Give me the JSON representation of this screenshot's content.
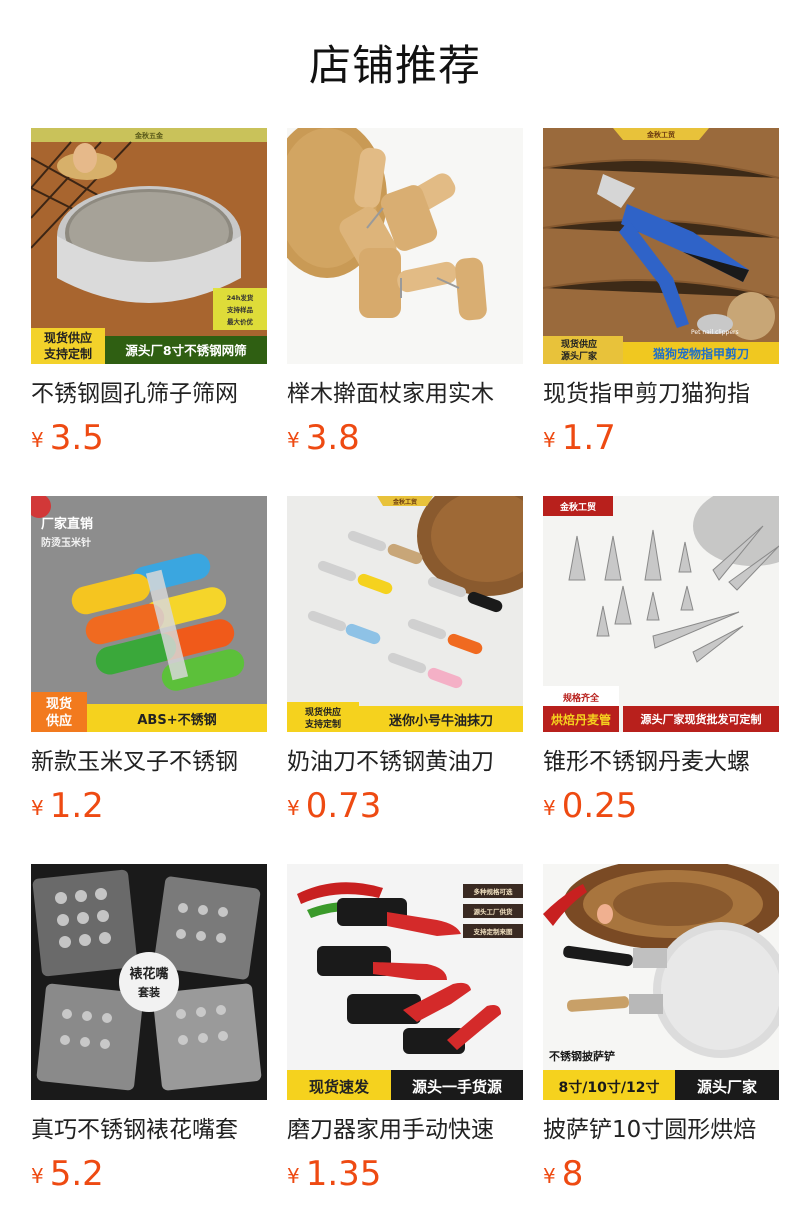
{
  "page": {
    "title": "店铺推荐"
  },
  "currency": "¥",
  "products": [
    {
      "name": "不锈钢圆孔筛子筛网",
      "price": "3.5",
      "image": {
        "icon": "sieve-image",
        "top_text": "金秋五金",
        "badge_lines": [
          "现货供应",
          "支持定制"
        ],
        "banner": "源头厂8寸不锈钢网筛",
        "tags": [
          "24h发货",
          "支持样品",
          "最大价优"
        ]
      }
    },
    {
      "name": "榉木擀面杖家用实木",
      "price": "3.8",
      "image": {
        "icon": "rolling-pin-image"
      }
    },
    {
      "name": "现货指甲剪刀猫狗指",
      "price": "1.7",
      "image": {
        "icon": "pet-nail-clipper-image",
        "top_text": "金秋工贸",
        "badge_lines": [
          "现货供应",
          "源头厂家"
        ],
        "banner": "猫狗宠物指甲剪刀",
        "small_text": "Pet nail clippers"
      }
    },
    {
      "name": "新款玉米叉子不锈钢",
      "price": "1.2",
      "image": {
        "icon": "corn-holder-image",
        "corner_lines": [
          "厂家直销",
          "防烫玉米针"
        ],
        "badge_lines": [
          "现货",
          "供应"
        ],
        "banner": "ABS+不锈钢"
      }
    },
    {
      "name": "奶油刀不锈钢黄油刀",
      "price": "0.73",
      "image": {
        "icon": "butter-knife-image",
        "top_text": "金秋工贸",
        "badge_lines": [
          "现货供应",
          "支持定制"
        ],
        "banner": "迷你小号牛油抹刀"
      }
    },
    {
      "name": "锥形不锈钢丹麦大螺",
      "price": "0.25",
      "image": {
        "icon": "cone-mold-image",
        "corner_lines": [
          "金秋工贸"
        ],
        "badge_lines": [
          "规格齐全",
          "烘焙丹麦管"
        ],
        "banner": "源头厂家现货批发可定制"
      }
    },
    {
      "name": "真巧不锈钢裱花嘴套",
      "price": "5.2",
      "image": {
        "icon": "piping-tip-set-image",
        "center_lines": [
          "裱花嘴",
          "套装"
        ]
      }
    },
    {
      "name": "磨刀器家用手动快速",
      "price": "1.35",
      "image": {
        "icon": "knife-sharpener-image",
        "badge_lines": [
          "现货速发"
        ],
        "banner": "源头一手货源",
        "tags": [
          "多种规格可选",
          "源头工厂供货",
          "支持定制来图"
        ]
      }
    },
    {
      "name": "披萨铲10寸圆形烘焙",
      "price": "8",
      "image": {
        "icon": "pizza-peel-image",
        "caption": "不锈钢披萨铲",
        "badge_lines": [
          "8寸/10寸/12寸"
        ],
        "banner": "源头厂家"
      }
    }
  ]
}
